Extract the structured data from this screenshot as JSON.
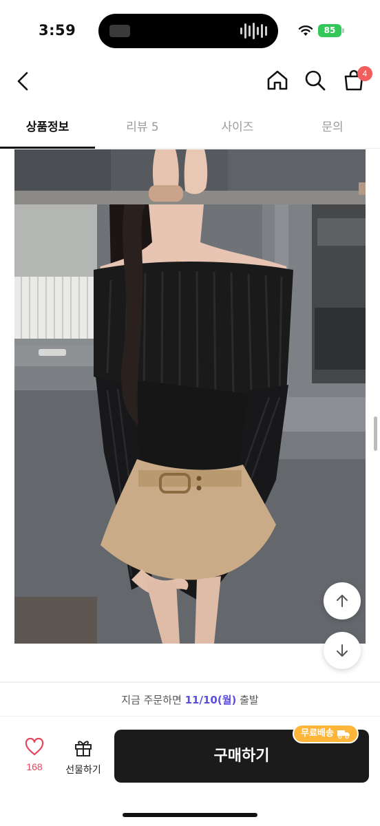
{
  "status_bar": {
    "time": "3:59",
    "battery": "85"
  },
  "nav": {
    "cart_count": "4"
  },
  "tabs": [
    {
      "label": "상품정보",
      "active": true
    },
    {
      "label": "리뷰 5",
      "active": false
    },
    {
      "label": "사이즈",
      "active": false
    },
    {
      "label": "문의",
      "active": false
    }
  ],
  "shipping": {
    "prefix": "지금 주문하면 ",
    "date": "11/10(월)",
    "suffix": " 출발"
  },
  "actions": {
    "like_count": "168",
    "gift_label": "선물하기",
    "buy_label": "구매하기",
    "free_shipping_label": "무료배송"
  },
  "colors": {
    "accent": "#5b4de0",
    "like": "#e8445a",
    "badge": "#ffb53a",
    "buy": "#1b1b1b"
  }
}
